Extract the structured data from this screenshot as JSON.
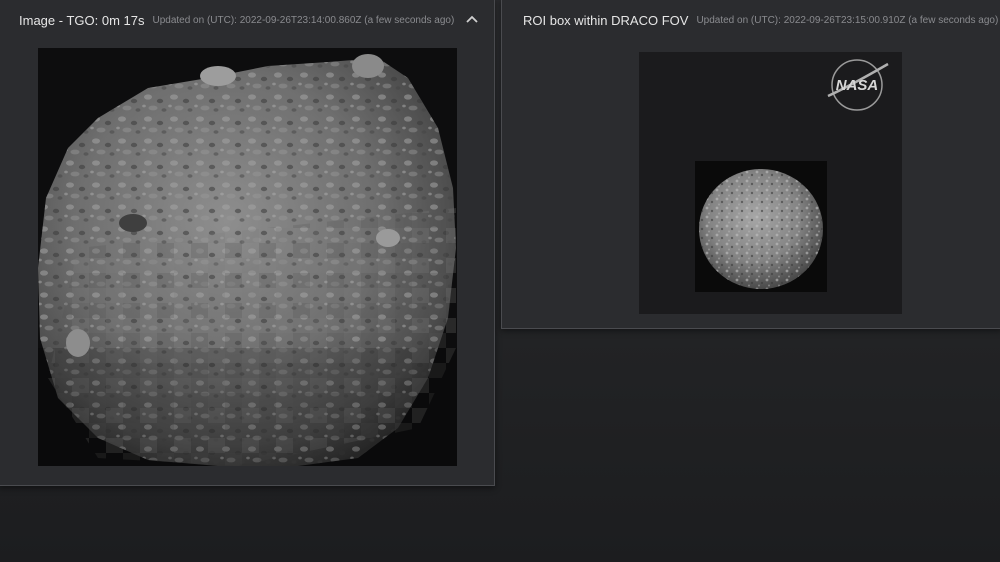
{
  "left_panel": {
    "title": "Image - TGO: 0m 17s",
    "updated": "Updated on (UTC): 2022-09-26T23:14:00.860Z (a few seconds ago)",
    "collapse_icon": "chevron-up-icon"
  },
  "right_panel": {
    "title": "ROI box within DRACO FOV",
    "updated": "Updated on (UTC): 2022-09-26T23:15:00.910Z (a few seconds ago)",
    "logo_text": "NASA"
  },
  "colors": {
    "background": "#252628",
    "panel": "#2b2c2f",
    "title_text": "#e6e6e6",
    "meta_text": "#8a8b8f"
  }
}
